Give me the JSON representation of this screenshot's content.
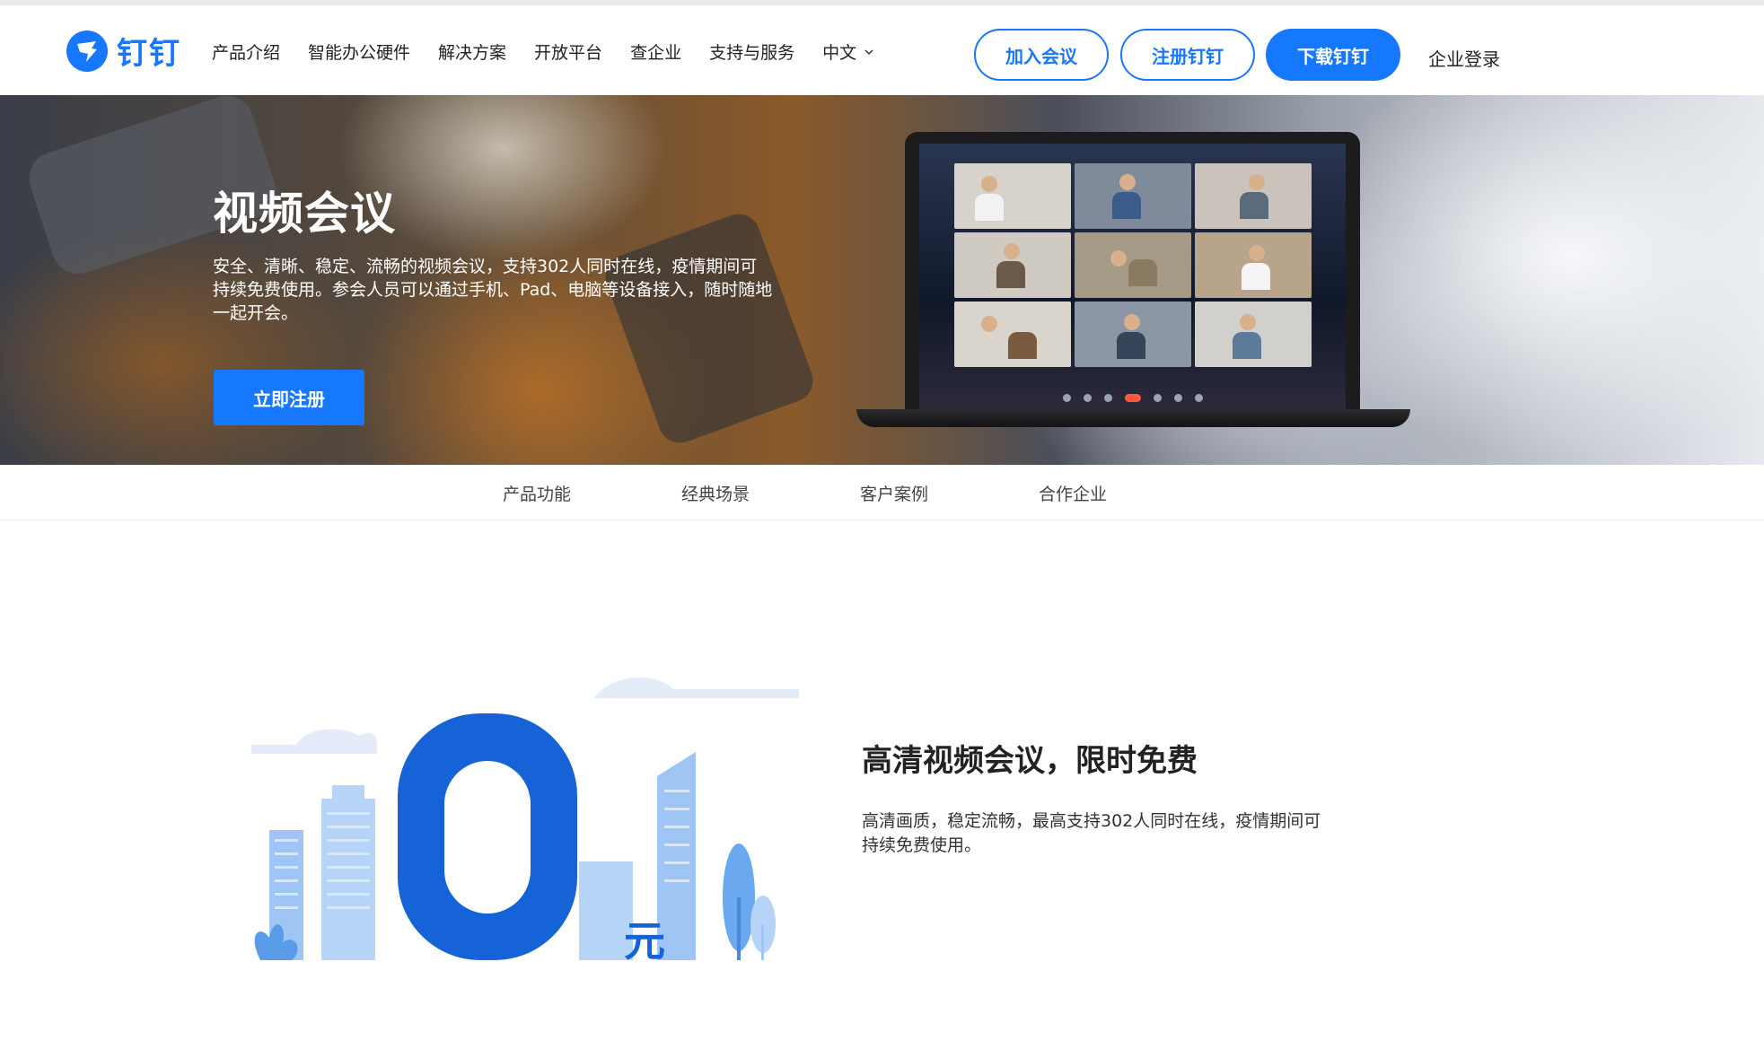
{
  "brand": {
    "name": "钉钉",
    "color": "#1677ff"
  },
  "nav": {
    "items": [
      {
        "label": "产品介绍"
      },
      {
        "label": "智能办公硬件"
      },
      {
        "label": "解决方案"
      },
      {
        "label": "开放平台"
      },
      {
        "label": "查企业"
      },
      {
        "label": "支持与服务"
      }
    ],
    "language": {
      "label": "中文",
      "icon": "chevron-down-icon"
    }
  },
  "actions": {
    "join_meeting": "加入会议",
    "register": "注册钉钉",
    "download": "下载钉钉",
    "login": "企业登录"
  },
  "hero": {
    "title": "视频会议",
    "description": "安全、清晰、稳定、流畅的视频会议，支持302人同时在线，疫情期间可持续免费使用。参会人员可以通过手机、Pad、电脑等设备接入，随时随地一起开会。",
    "cta": "立即注册"
  },
  "subnav": {
    "items": [
      {
        "label": "产品功能"
      },
      {
        "label": "经典场景"
      },
      {
        "label": "客户案例"
      },
      {
        "label": "合作企业"
      }
    ]
  },
  "feature": {
    "title": "高清视频会议，限时免费",
    "description": "高清画质，稳定流畅，最高支持302人同时在线，疫情期间可持续免费使用。",
    "illustration": {
      "big_text": "0",
      "unit": "元"
    }
  }
}
